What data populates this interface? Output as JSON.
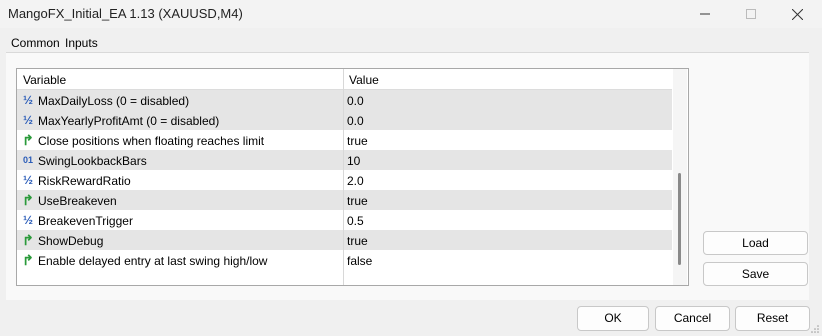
{
  "window": {
    "title": "MangoFX_Initial_EA 1.13 (XAUUSD,M4)",
    "controls": [
      "minimize-icon",
      "maximize-icon",
      "close-icon"
    ]
  },
  "tabs": [
    {
      "label": "Common",
      "selected": false
    },
    {
      "label": "Inputs",
      "selected": true
    }
  ],
  "grid": {
    "columns": {
      "variable": "Variable",
      "value": "Value"
    },
    "rows": [
      {
        "icon": "half-icon",
        "variable": "MaxDailyLoss (0 = disabled)",
        "value": "0.0"
      },
      {
        "icon": "half-icon",
        "variable": "MaxYearlyProfitAmt (0 = disabled)",
        "value": "0.0"
      },
      {
        "icon": "bool-arrow-icon",
        "variable": "Close positions when floating reaches limit",
        "value": "true"
      },
      {
        "icon": "int-icon",
        "variable": "SwingLookbackBars",
        "value": "10"
      },
      {
        "icon": "half-icon",
        "variable": "RiskRewardRatio",
        "value": "2.0"
      },
      {
        "icon": "bool-arrow-icon",
        "variable": "UseBreakeven",
        "value": "true"
      },
      {
        "icon": "half-icon",
        "variable": "BreakevenTrigger",
        "value": "0.5"
      },
      {
        "icon": "bool-arrow-icon",
        "variable": "ShowDebug",
        "value": "true"
      },
      {
        "icon": "bool-arrow-icon",
        "variable": "Enable delayed entry at last swing high/low",
        "value": "false"
      }
    ]
  },
  "side_buttons": {
    "load": "Load",
    "save": "Save"
  },
  "footer_buttons": {
    "ok": "OK",
    "cancel": "Cancel",
    "reset": "Reset"
  },
  "icon_glyphs": {
    "half": "½",
    "int": "01",
    "bool": "↱"
  },
  "colors": {
    "accent": "#0a64c8",
    "row_alt": "#e5e5e5",
    "bool_icon": "#2a9a3a",
    "num_icon": "#2a5cb8"
  }
}
